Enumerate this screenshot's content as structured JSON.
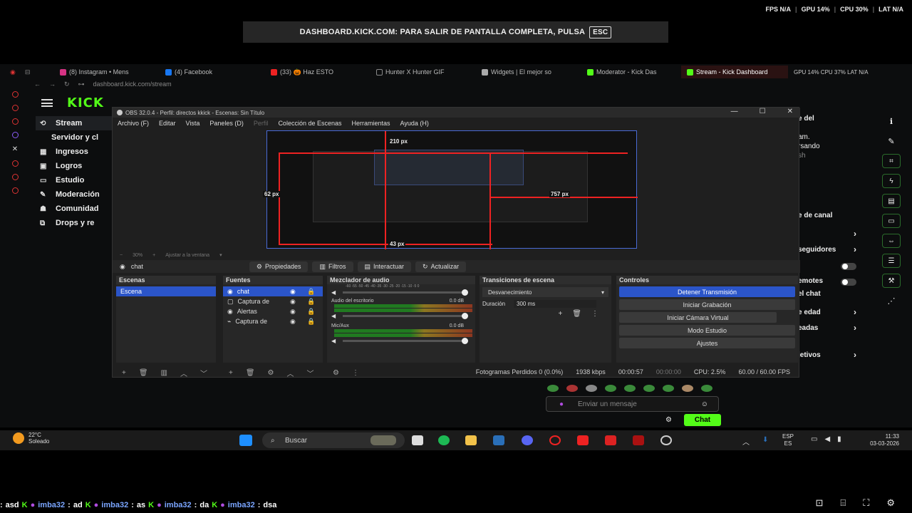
{
  "perf": {
    "fps": "FPS N/A",
    "gpu": "GPU 14%",
    "cpu": "CPU 30%",
    "lat": "LAT N/A"
  },
  "fullscreen_notice": {
    "text": "DASHBOARD.KICK.COM: PARA SALIR DE PANTALLA COMPLETA, PULSA",
    "key": "ESC"
  },
  "browser": {
    "tabs": [
      {
        "label": "(8) Instagram • Mens",
        "color": "#d63384"
      },
      {
        "label": "(4) Facebook",
        "color": "#1877f2"
      },
      {
        "label": "(33) 🎃 Haz ESTO",
        "color": "#e22"
      },
      {
        "label": "Hunter X Hunter GIF",
        "color": "#888"
      },
      {
        "label": "Widgets | El mejor so",
        "color": "#aaa"
      },
      {
        "label": "Moderator - Kick Das",
        "color": "#53fc18"
      },
      {
        "label": "Stream - Kick Dashboard",
        "color": "#53fc18"
      }
    ],
    "tab_perf": "GPU 14%   CPU 37%   LAT N/A",
    "url": "dashboard.kick.com/stream"
  },
  "kick": {
    "logo": "KICK",
    "nav": [
      {
        "label": "Stream",
        "icon": "⟲"
      },
      {
        "label": "Servidor y cl",
        "icon": ""
      },
      {
        "label": "Ingresos",
        "icon": "▦"
      },
      {
        "label": "Logros",
        "icon": "▣"
      },
      {
        "label": "Estudio",
        "icon": "▭"
      },
      {
        "label": "Moderación",
        "icon": "✎"
      },
      {
        "label": "Comunidad",
        "icon": "☗"
      },
      {
        "label": "Drops y re",
        "icon": "⧉"
      }
    ],
    "right_panel": {
      "line1": "e del",
      "line2": "am.",
      "line3": "rsando",
      "line4": "sh",
      "items": [
        "e de canal",
        "seguidores",
        "emotes",
        "el chat",
        "e edad",
        "eadas",
        "jetivos"
      ]
    },
    "chat_placeholder": "Enviar un mensaje",
    "chat_button": "Chat"
  },
  "obs": {
    "title": "OBS 32.0.4 - Perfil: directos kkick - Escenas: Sin Título",
    "menu": [
      "Archivo (F)",
      "Editar",
      "Vista",
      "Paneles (D)",
      "Perfil",
      "Colección de Escenas",
      "Herramientas",
      "Ayuda (H)"
    ],
    "preview_measures": {
      "top": "210 px",
      "left": "62 px",
      "right": "757 px",
      "bottom": "43 px"
    },
    "zoom": "30%",
    "fit": "Ajustar a la ventana",
    "selected_source": "chat",
    "source_buttons": [
      "Propiedades",
      "Filtros",
      "Interactuar",
      "Actualizar"
    ],
    "docks": {
      "scenes": {
        "title": "Escenas",
        "items": [
          "Escena"
        ]
      },
      "sources": {
        "title": "Fuentes",
        "items": [
          "chat",
          "Captura de",
          "Alertas",
          "Captura de"
        ]
      },
      "mixer": {
        "title": "Mezclador de audio",
        "channels": [
          {
            "name": "",
            "db": ""
          },
          {
            "name": "Audio del escritorio",
            "db": "0.0 dB"
          },
          {
            "name": "Mic/Aux",
            "db": "0.0 dB"
          }
        ],
        "scale": "-60 -55 -50 -45 -40 -35 -30 -25 -20 -15 -10 -5 0"
      },
      "transitions": {
        "title": "Transiciones de escena",
        "type": "Desvanecimiento",
        "duration_label": "Duración",
        "duration": "300 ms"
      },
      "controls": {
        "title": "Controles",
        "buttons": [
          "Detener Transmisión",
          "Iniciar Grabación",
          "Iniciar Cámara Virtual",
          "Modo Estudio",
          "Ajustes"
        ]
      }
    },
    "status": {
      "dropped": "Fotogramas Perdidos 0 (0.0%)",
      "bitrate": "1938 kbps",
      "stream_time": "00:00:57",
      "rec_time": "00:00:00",
      "cpu": "CPU: 2.5%",
      "fps": "60.00 / 60.00 FPS"
    }
  },
  "taskbar": {
    "temp": "22°C",
    "weather": "Soleado",
    "search": "Buscar",
    "lang1": "ESP",
    "lang2": "ES",
    "time": "11:33",
    "date": "03-03-2026"
  },
  "bottom_chat": [
    {
      "user": "",
      "msg": "asd"
    },
    {
      "user": "imba32",
      "msg": "ad"
    },
    {
      "user": "imba32",
      "msg": "as"
    },
    {
      "user": "imba32",
      "msg": "da"
    },
    {
      "user": "imba32",
      "msg": "dsa"
    }
  ],
  "colors": {
    "kick_green": "#53fc18",
    "obs_blue": "#2b55c9",
    "red_guide": "#ee2222"
  }
}
